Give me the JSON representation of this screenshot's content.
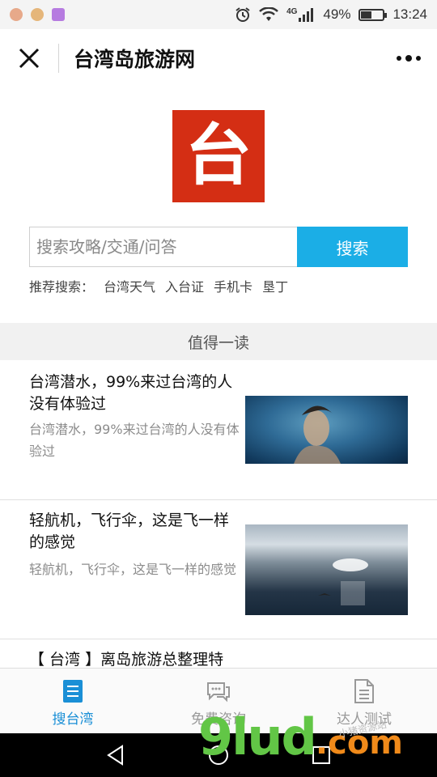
{
  "status_bar": {
    "battery": "49%",
    "battery_level": 0.49,
    "network": "4G",
    "time": "13:24"
  },
  "header": {
    "title": "台湾岛旅游网"
  },
  "logo": {
    "text": "台",
    "color": "#d42e14"
  },
  "search": {
    "placeholder": "搜索攻略/交通/问答",
    "button_label": "搜索",
    "accent": "#1baee6"
  },
  "recommend": {
    "label": "推荐搜索：",
    "items": [
      "台湾天气",
      "入台证",
      "手机卡",
      "垦丁"
    ]
  },
  "section": {
    "title": "值得一读"
  },
  "articles": [
    {
      "title": "台湾潜水，99%来过台湾的人没有体验过",
      "desc": "台湾潜水，99%来过台湾的人没有体验过"
    },
    {
      "title": "轻航机，飞行伞，这是飞一样的感觉",
      "desc": "轻航机，飞行伞，这是飞一样的感觉"
    },
    {
      "title": "【 台湾 】离岛旅游总整理特"
    }
  ],
  "bottom_nav": {
    "items": [
      {
        "label": "搜台湾",
        "icon": "document-list-icon",
        "active": true
      },
      {
        "label": "免费咨询",
        "icon": "chat-bubbles-icon",
        "active": false
      },
      {
        "label": "达人测试",
        "icon": "document-icon",
        "active": false
      }
    ],
    "active_color": "#1a8fd6"
  },
  "watermark": {
    "main": "9lud",
    "suffix": ".com",
    "small": "小猪资源站"
  }
}
